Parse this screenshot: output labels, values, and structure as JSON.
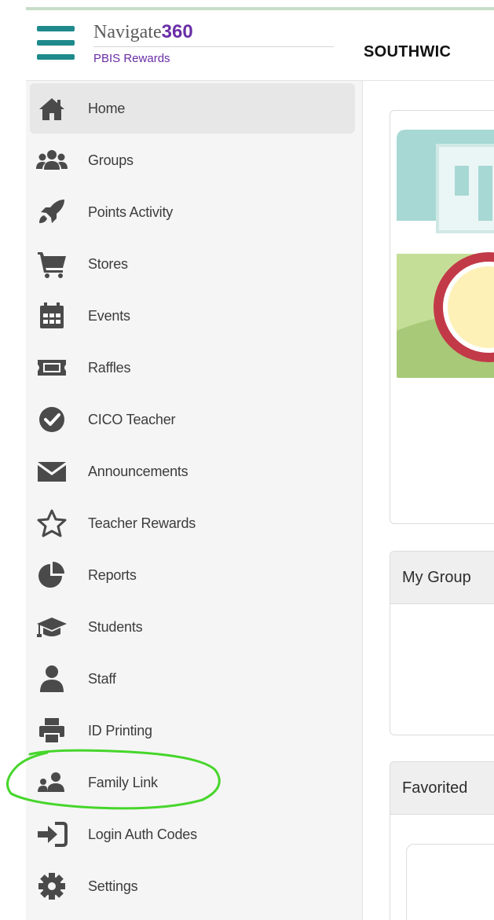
{
  "header": {
    "brand_main": "Navigate",
    "brand_number": "360",
    "brand_sub": "PBIS Rewards",
    "school_name": "SOUTHWIC"
  },
  "sidebar": {
    "items": [
      {
        "label": "Home",
        "icon": "home-icon"
      },
      {
        "label": "Groups",
        "icon": "users-icon"
      },
      {
        "label": "Points Activity",
        "icon": "rocket-icon"
      },
      {
        "label": "Stores",
        "icon": "cart-icon"
      },
      {
        "label": "Events",
        "icon": "calendar-icon"
      },
      {
        "label": "Raffles",
        "icon": "ticket-icon"
      },
      {
        "label": "CICO Teacher",
        "icon": "check-circle-icon"
      },
      {
        "label": "Announcements",
        "icon": "envelope-icon"
      },
      {
        "label": "Teacher Rewards",
        "icon": "star-icon"
      },
      {
        "label": "Reports",
        "icon": "pie-chart-icon"
      },
      {
        "label": "Students",
        "icon": "graduation-cap-icon"
      },
      {
        "label": "Staff",
        "icon": "person-icon"
      },
      {
        "label": "ID Printing",
        "icon": "printer-icon"
      },
      {
        "label": "Family Link",
        "icon": "family-icon"
      },
      {
        "label": "Login Auth Codes",
        "icon": "sign-in-icon"
      },
      {
        "label": "Settings",
        "icon": "gear-icon"
      }
    ],
    "active_item": "Home",
    "highlighted_item": "Family Link"
  },
  "main": {
    "card_my_groups_title": "My Group",
    "card_favorites_title": "Favorited"
  },
  "colors": {
    "brand_teal": "#1e8a8c",
    "brand_purple": "#6a2da6",
    "icon_gray": "#4a4a4a",
    "highlight_green": "#46d62b"
  }
}
